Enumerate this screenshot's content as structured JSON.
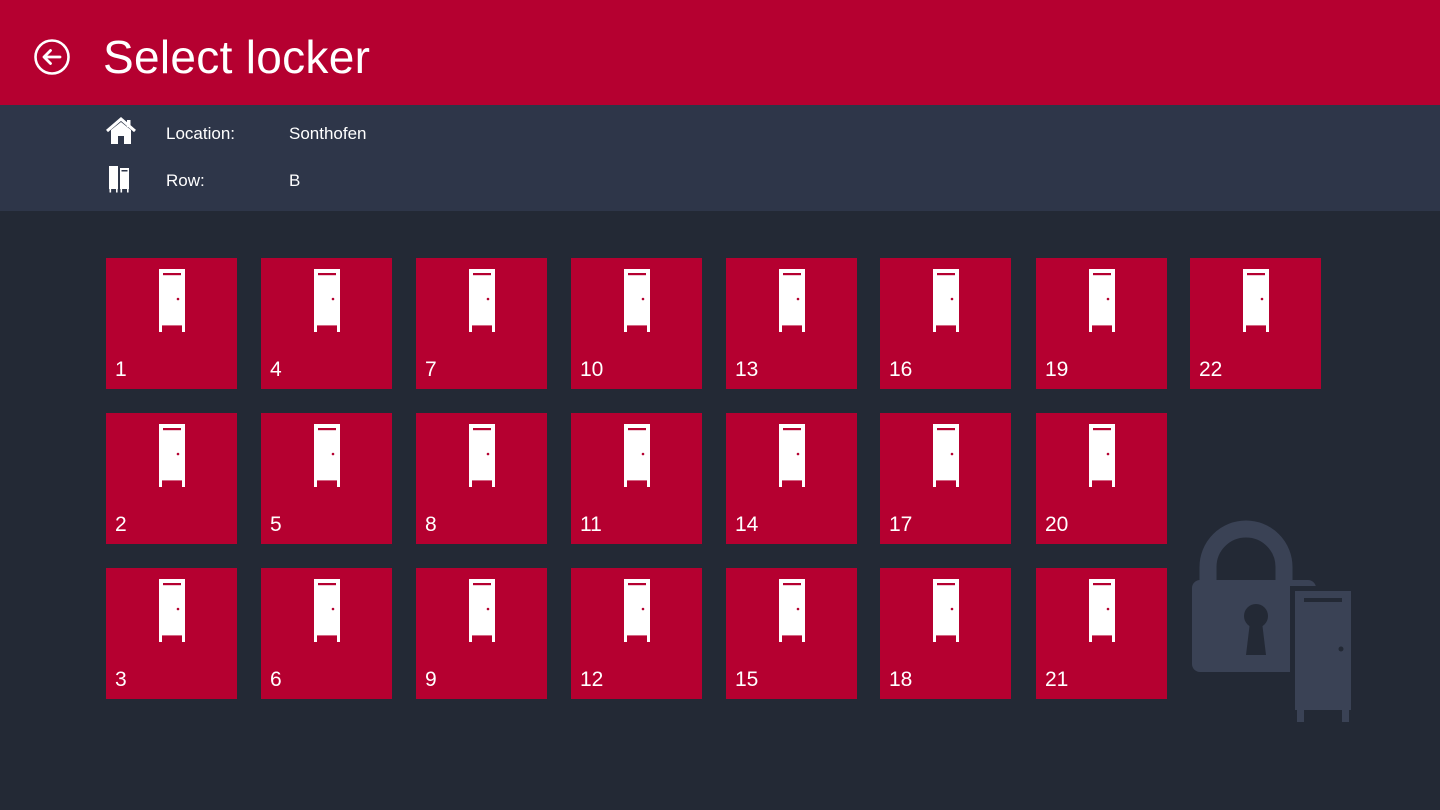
{
  "header": {
    "title": "Select locker"
  },
  "info": {
    "location_label": "Location:",
    "location_value": "Sonthofen",
    "row_label": "Row:",
    "row_value": "B"
  },
  "lockers": [
    {
      "number": "1"
    },
    {
      "number": "2"
    },
    {
      "number": "3"
    },
    {
      "number": "4"
    },
    {
      "number": "5"
    },
    {
      "number": "6"
    },
    {
      "number": "7"
    },
    {
      "number": "8"
    },
    {
      "number": "9"
    },
    {
      "number": "10"
    },
    {
      "number": "11"
    },
    {
      "number": "12"
    },
    {
      "number": "13"
    },
    {
      "number": "14"
    },
    {
      "number": "15"
    },
    {
      "number": "16"
    },
    {
      "number": "17"
    },
    {
      "number": "18"
    },
    {
      "number": "19"
    },
    {
      "number": "20"
    },
    {
      "number": "21"
    },
    {
      "number": "22"
    }
  ],
  "icons": {
    "back": "back-arrow-icon",
    "location": "home-icon",
    "row": "locker-row-icon",
    "tile": "locker-icon",
    "watermark": "unlocked-padlock-locker-icon"
  },
  "colors": {
    "accent": "#b50030",
    "info_bar": "#2e3649",
    "background": "#232935",
    "watermark": "#3a4255"
  }
}
